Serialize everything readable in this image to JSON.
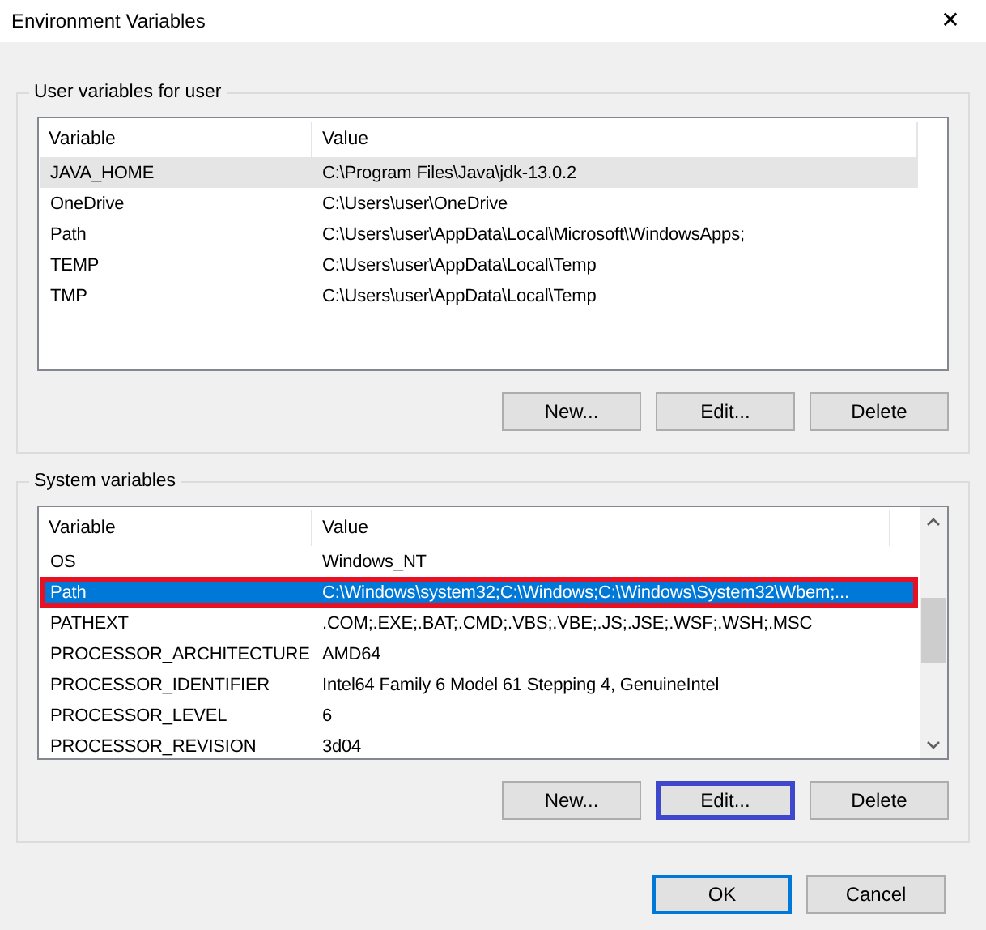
{
  "window": {
    "title": "Environment Variables",
    "close": "✕"
  },
  "user_variables": {
    "title": "User variables for user",
    "columns": [
      "Variable",
      "Value"
    ],
    "rows": [
      {
        "variable": "JAVA_HOME",
        "value": "C:\\Program Files\\Java\\jdk-13.0.2",
        "hovered": true
      },
      {
        "variable": "OneDrive",
        "value": "C:\\Users\\user\\OneDrive",
        "hovered": false
      },
      {
        "variable": "Path",
        "value": "C:\\Users\\user\\AppData\\Local\\Microsoft\\WindowsApps;",
        "hovered": false
      },
      {
        "variable": "TEMP",
        "value": "C:\\Users\\user\\AppData\\Local\\Temp",
        "hovered": false
      },
      {
        "variable": "TMP",
        "value": "C:\\Users\\user\\AppData\\Local\\Temp",
        "hovered": false
      }
    ],
    "buttons": [
      {
        "label": "New...",
        "highlighted": false
      },
      {
        "label": "Edit...",
        "highlighted": false
      },
      {
        "label": "Delete",
        "highlighted": false
      }
    ]
  },
  "system_variables": {
    "title": "System variables",
    "columns": [
      "Variable",
      "Value"
    ],
    "rows": [
      {
        "variable": "OS",
        "value": "Windows_NT",
        "selected": false,
        "highlighted": false
      },
      {
        "variable": "Path",
        "value": "C:\\Windows\\system32;C:\\Windows;C:\\Windows\\System32\\Wbem;...",
        "selected": true,
        "highlighted": true
      },
      {
        "variable": "PATHEXT",
        "value": ".COM;.EXE;.BAT;.CMD;.VBS;.VBE;.JS;.JSE;.WSF;.WSH;.MSC",
        "selected": false,
        "highlighted": false
      },
      {
        "variable": "PROCESSOR_ARCHITECTURE",
        "value": "AMD64",
        "selected": false,
        "highlighted": false
      },
      {
        "variable": "PROCESSOR_IDENTIFIER",
        "value": "Intel64 Family 6 Model 61 Stepping 4, GenuineIntel",
        "selected": false,
        "highlighted": false
      },
      {
        "variable": "PROCESSOR_LEVEL",
        "value": "6",
        "selected": false,
        "highlighted": false
      },
      {
        "variable": "PROCESSOR_REVISION",
        "value": "3d04",
        "selected": false,
        "highlighted": false
      }
    ],
    "buttons": [
      {
        "label": "New...",
        "highlighted": false
      },
      {
        "label": "Edit...",
        "highlighted": true
      },
      {
        "label": "Delete",
        "highlighted": false
      }
    ]
  },
  "dialog_buttons": [
    {
      "label": "OK",
      "default": true
    },
    {
      "label": "Cancel",
      "default": false
    }
  ]
}
